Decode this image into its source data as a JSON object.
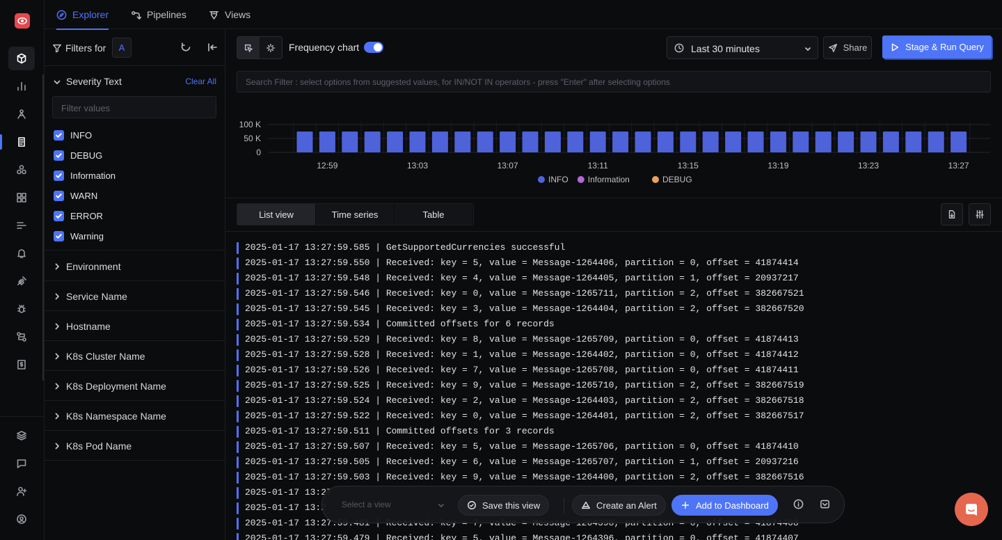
{
  "top_tabs": [
    {
      "label": "Explorer",
      "icon": "compass-icon",
      "active": true
    },
    {
      "label": "Pipelines",
      "icon": "pipelines-icon",
      "active": false
    },
    {
      "label": "Views",
      "icon": "views-icon",
      "active": false
    }
  ],
  "filters": {
    "title": "Filters for",
    "query_badge": "A",
    "severity": {
      "title": "Severity Text",
      "clear_label": "Clear All",
      "search_placeholder": "Filter values",
      "options": [
        "INFO",
        "DEBUG",
        "Information",
        "WARN",
        "ERROR",
        "Warning"
      ]
    },
    "groups": [
      "Environment",
      "Service Name",
      "Hostname",
      "K8s Cluster Name",
      "K8s Deployment Name",
      "K8s Namespace Name",
      "K8s Pod Name"
    ]
  },
  "toolbar": {
    "frequency_label": "Frequency chart",
    "frequency_enabled": true,
    "time_range": "Last 30 minutes",
    "share_label": "Share",
    "run_label": "Stage & Run Query"
  },
  "search": {
    "placeholder": "Search Filter : select options from suggested values, for IN/NOT IN operators - press \"Enter\" after selecting options"
  },
  "chart_data": {
    "type": "bar",
    "y_ticks": [
      "100 K",
      "50 K",
      "0"
    ],
    "ylim": [
      0,
      100000
    ],
    "x_ticks": [
      "12:59",
      "13:03",
      "13:07",
      "13:11",
      "13:15",
      "13:19",
      "13:23",
      "13:27"
    ],
    "categories": [
      "12:58",
      "12:59",
      "13:00",
      "13:01",
      "13:02",
      "13:03",
      "13:04",
      "13:05",
      "13:06",
      "13:07",
      "13:08",
      "13:09",
      "13:10",
      "13:11",
      "13:12",
      "13:13",
      "13:14",
      "13:15",
      "13:16",
      "13:17",
      "13:18",
      "13:19",
      "13:20",
      "13:21",
      "13:22",
      "13:23",
      "13:24",
      "13:25",
      "13:26",
      "13:27"
    ],
    "series": [
      {
        "name": "INFO",
        "color": "#4e62d9",
        "values": [
          75000,
          75000,
          75000,
          75000,
          75000,
          75000,
          75000,
          75000,
          75000,
          75000,
          75000,
          75000,
          75000,
          75000,
          75000,
          75000,
          75000,
          75000,
          75000,
          75000,
          75000,
          75000,
          75000,
          75000,
          75000,
          75000,
          75000,
          75000,
          75000,
          75000
        ]
      }
    ],
    "legend": [
      {
        "name": "INFO",
        "color": "#4e62d9"
      },
      {
        "name": "Information",
        "color": "#b566d8"
      },
      {
        "name": "DEBUG",
        "color": "#e8a35a"
      }
    ],
    "legend_position": "bottom",
    "grid": true
  },
  "view_tabs": [
    {
      "label": "List view",
      "active": true
    },
    {
      "label": "Time series",
      "active": false
    },
    {
      "label": "Table",
      "active": false
    }
  ],
  "logs": [
    "2025-01-17 13:27:59.585 | GetSupportedCurrencies successful",
    "2025-01-17 13:27:59.550 | Received: key = 5, value = Message-1264406, partition = 0, offset = 41874414",
    "2025-01-17 13:27:59.548 | Received: key = 4, value = Message-1264405, partition = 1, offset = 20937217",
    "2025-01-17 13:27:59.546 | Received: key = 0, value = Message-1265711, partition = 2, offset = 382667521",
    "2025-01-17 13:27:59.545 | Received: key = 3, value = Message-1264404, partition = 2, offset = 382667520",
    "2025-01-17 13:27:59.534 | Committed offsets for 6 records",
    "2025-01-17 13:27:59.529 | Received: key = 8, value = Message-1265709, partition = 0, offset = 41874413",
    "2025-01-17 13:27:59.528 | Received: key = 1, value = Message-1264402, partition = 0, offset = 41874412",
    "2025-01-17 13:27:59.526 | Received: key = 7, value = Message-1265708, partition = 0, offset = 41874411",
    "2025-01-17 13:27:59.525 | Received: key = 9, value = Message-1265710, partition = 2, offset = 382667519",
    "2025-01-17 13:27:59.524 | Received: key = 2, value = Message-1264403, partition = 2, offset = 382667518",
    "2025-01-17 13:27:59.522 | Received: key = 0, value = Message-1264401, partition = 2, offset = 382667517",
    "2025-01-17 13:27:59.511 | Committed offsets for 3 records",
    "2025-01-17 13:27:59.507 | Received: key = 5, value = Message-1265706, partition = 0, offset = 41874410",
    "2025-01-17 13:27:59.505 | Received: key = 6, value = Message-1265707, partition = 1, offset = 20937216",
    "2025-01-17 13:27:59.503 | Received: key = 9, value = Message-1264400, partition = 2, offset = 382667516",
    "2025-01-17 13:27",
    "2025-01-17 13:2",
    "2025-01-17 13:27:59.481 | Received: key = 7, value = Message-1264398, partition = 0, offset = 41874408",
    "2025-01-17 13:27:59.479 | Received: key = 5, value = Message-1264396, partition = 0, offset = 41874407"
  ],
  "action_bar": {
    "select_placeholder": "Select a view",
    "save_label": "Save this view",
    "alert_label": "Create an Alert",
    "dashboard_label": "Add to Dashboard"
  },
  "colors": {
    "accent": "#4e74f8",
    "brand": "#e5484d",
    "chat": "#e5674e"
  }
}
